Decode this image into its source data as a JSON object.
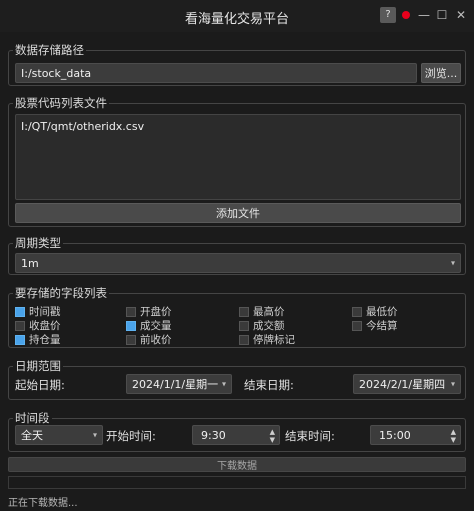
{
  "window": {
    "title": "看海量化交易平台",
    "help_label": "?",
    "minimize_glyph": "—",
    "maximize_glyph": "☐",
    "close_glyph": "✕",
    "record_color": "#e8001c"
  },
  "storage": {
    "group_title": "数据存储路径",
    "path_value": "I:/stock_data",
    "browse_label": "浏览..."
  },
  "stock_files": {
    "group_title": "股票代码列表文件",
    "files_text": "I:/QT/qmt/otheridx.csv",
    "add_label": "添加文件"
  },
  "period": {
    "group_title": "周期类型",
    "selected": "1m"
  },
  "fields": {
    "group_title": "要存储的字段列表",
    "items": [
      {
        "label": "时间戳",
        "checked": true
      },
      {
        "label": "开盘价",
        "checked": false
      },
      {
        "label": "最高价",
        "checked": false
      },
      {
        "label": "最低价",
        "checked": false
      },
      {
        "label": "收盘价",
        "checked": false
      },
      {
        "label": "成交量",
        "checked": true
      },
      {
        "label": "成交额",
        "checked": false
      },
      {
        "label": "今结算",
        "checked": false
      },
      {
        "label": "持仓量",
        "checked": true
      },
      {
        "label": "前收价",
        "checked": false
      },
      {
        "label": "停牌标记",
        "checked": false
      }
    ],
    "checked_color": "#4aa3ea"
  },
  "date_range": {
    "group_title": "日期范围",
    "start_label": "起始日期:",
    "start_value": "2024/1/1/星期一",
    "end_label": "结束日期:",
    "end_value": "2024/2/1/星期四"
  },
  "time_range": {
    "group_title": "时间段",
    "preset": "全天",
    "start_label": "开始时间:",
    "start_value": "9:30",
    "end_label": "结束时间:",
    "end_value": "15:00"
  },
  "actions": {
    "download_label": "下载数据"
  },
  "status": {
    "text": "正在下载数据..."
  }
}
